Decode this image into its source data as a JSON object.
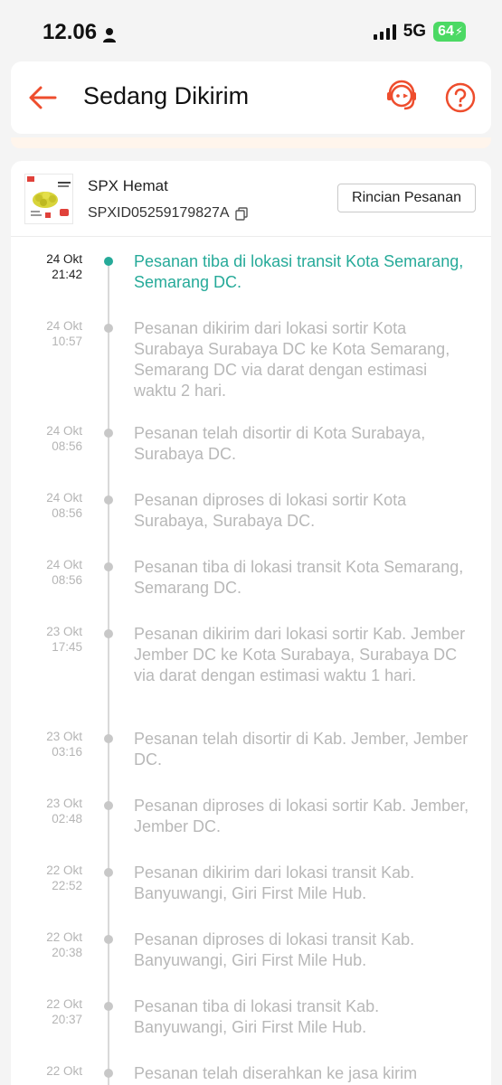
{
  "status_bar": {
    "time": "12.06",
    "network": "5G",
    "battery": "64"
  },
  "header": {
    "title": "Sedang Dikirim"
  },
  "order": {
    "courier": "SPX Hemat",
    "tracking_number": "SPXID05259179827A",
    "details_button": "Rincian Pesanan"
  },
  "colors": {
    "accent": "#ee4d2d",
    "current_status": "#26aa99",
    "muted_text": "#b8b8b8"
  },
  "timeline": [
    {
      "date": "24 Okt",
      "time": "21:42",
      "text": "Pesanan tiba di lokasi transit Kota Semarang, Semarang DC."
    },
    {
      "date": "24 Okt",
      "time": "10:57",
      "text": "Pesanan dikirim dari lokasi sortir Kota Surabaya  Surabaya DC ke Kota Semarang, Semarang DC via darat dengan estimasi waktu 2 hari."
    },
    {
      "date": "24 Okt",
      "time": "08:56",
      "text": "Pesanan telah disortir di Kota Surabaya, Surabaya DC."
    },
    {
      "date": "24 Okt",
      "time": "08:56",
      "text": "Pesanan diproses di lokasi sortir Kota Surabaya, Surabaya DC."
    },
    {
      "date": "24 Okt",
      "time": "08:56",
      "text": "Pesanan tiba di lokasi transit Kota Semarang, Semarang DC."
    },
    {
      "date": "23 Okt",
      "time": "17:45",
      "text": "Pesanan dikirim dari lokasi sortir Kab. Jember  Jember DC ke Kota Surabaya, Surabaya DC via darat dengan estimasi waktu 1 hari."
    },
    {
      "date": "23 Okt",
      "time": "03:16",
      "text": "Pesanan telah disortir di Kab. Jember, Jember DC."
    },
    {
      "date": "23 Okt",
      "time": "02:48",
      "text": "Pesanan diproses di lokasi sortir Kab. Jember, Jember DC."
    },
    {
      "date": "22 Okt",
      "time": "22:52",
      "text": "Pesanan dikirim dari lokasi transit Kab. Banyuwangi, Giri First Mile Hub."
    },
    {
      "date": "22 Okt",
      "time": "20:38",
      "text": "Pesanan diproses di lokasi transit Kab. Banyuwangi, Giri First Mile Hub."
    },
    {
      "date": "22 Okt",
      "time": "20:37",
      "text": "Pesanan tiba di lokasi transit Kab. Banyuwangi, Giri First Mile Hub."
    },
    {
      "date": "22 Okt",
      "time": "",
      "text": "Pesanan telah diserahkan ke jasa kirim"
    }
  ]
}
